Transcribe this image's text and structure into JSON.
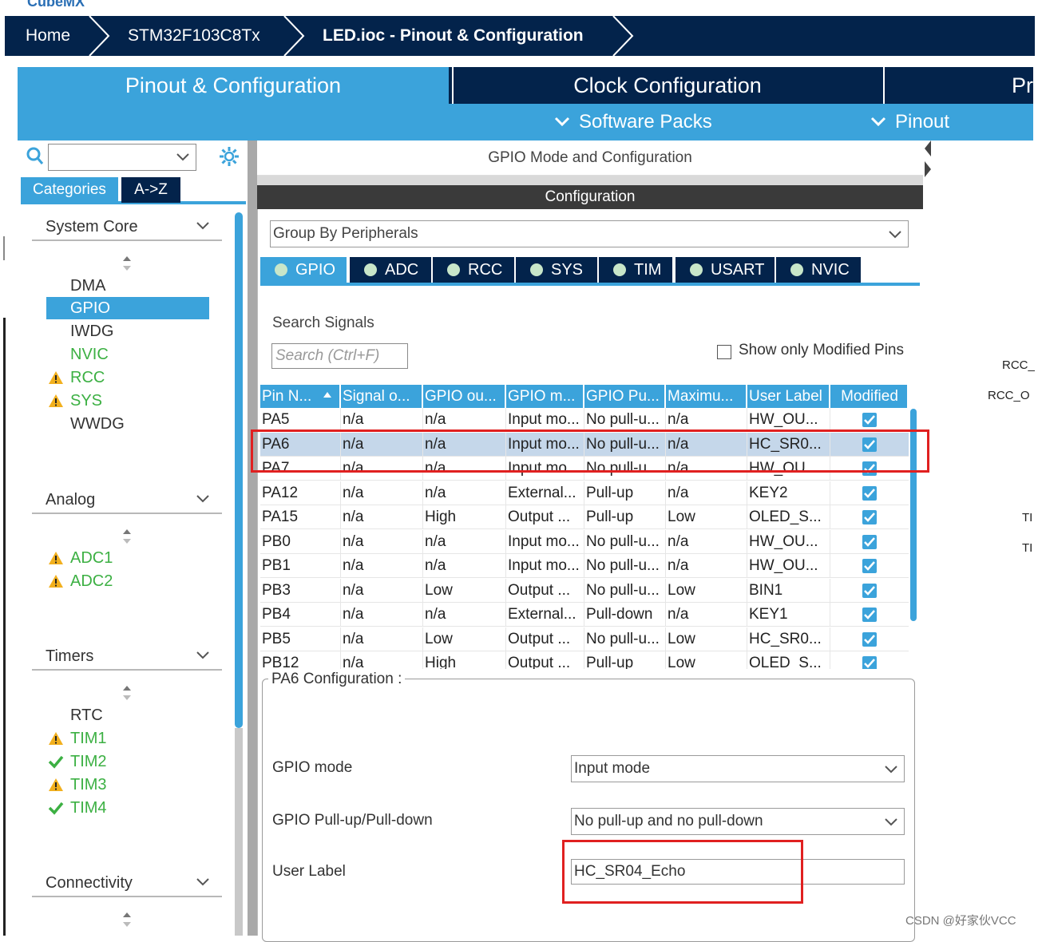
{
  "app": {
    "logo_text": "CubeMX"
  },
  "breadcrumb": [
    "Home",
    "STM32F103C8Tx",
    "LED.ioc - Pinout & Configuration"
  ],
  "main_tabs": [
    "Pinout & Configuration",
    "Clock Configuration",
    "Pr"
  ],
  "sub_tabs": [
    "Software Packs",
    "Pinout"
  ],
  "left": {
    "search_value": "",
    "cat_tabs": [
      "Categories",
      "A->Z"
    ],
    "sections": {
      "system_core": {
        "title": "System Core",
        "items": [
          {
            "label": "DMA",
            "status": "none"
          },
          {
            "label": "GPIO",
            "status": "selected"
          },
          {
            "label": "IWDG",
            "status": "none"
          },
          {
            "label": "NVIC",
            "status": "ok"
          },
          {
            "label": "RCC",
            "status": "warning"
          },
          {
            "label": "SYS",
            "status": "warning"
          },
          {
            "label": "WWDG",
            "status": "none"
          }
        ]
      },
      "analog": {
        "title": "Analog",
        "items": [
          {
            "label": "ADC1",
            "status": "warning"
          },
          {
            "label": "ADC2",
            "status": "warning"
          }
        ]
      },
      "timers": {
        "title": "Timers",
        "items": [
          {
            "label": "RTC",
            "status": "none"
          },
          {
            "label": "TIM1",
            "status": "warning"
          },
          {
            "label": "TIM2",
            "status": "checked"
          },
          {
            "label": "TIM3",
            "status": "warning"
          },
          {
            "label": "TIM4",
            "status": "checked"
          }
        ]
      },
      "connectivity": {
        "title": "Connectivity"
      }
    }
  },
  "center": {
    "header": "GPIO Mode and Configuration",
    "config_header": "Configuration",
    "group_by": "Group By Peripherals",
    "peripheral_tabs": [
      "GPIO",
      "ADC",
      "RCC",
      "SYS",
      "TIM",
      "USART",
      "NVIC"
    ],
    "search_label": "Search Signals",
    "search_placeholder": "Search (Ctrl+F)",
    "show_modified_label": "Show only Modified Pins",
    "table": {
      "columns": [
        "Pin N...",
        "Signal o...",
        "GPIO ou...",
        "GPIO m...",
        "GPIO Pu...",
        "Maximu...",
        "User Label",
        "Modified"
      ],
      "rows": [
        [
          "PA5",
          "n/a",
          "n/a",
          "Input mo...",
          "No pull-u...",
          "n/a",
          "HW_OU...",
          true
        ],
        [
          "PA6",
          "n/a",
          "n/a",
          "Input mo...",
          "No pull-u...",
          "n/a",
          "HC_SR0...",
          true
        ],
        [
          "PA7",
          "n/a",
          "n/a",
          "Input mo...",
          "No pull-u...",
          "n/a",
          "HW_OU...",
          true
        ],
        [
          "PA12",
          "n/a",
          "n/a",
          "External...",
          "Pull-up",
          "n/a",
          "KEY2",
          true
        ],
        [
          "PA15",
          "n/a",
          "High",
          "Output ...",
          "Pull-up",
          "Low",
          "OLED_S...",
          true
        ],
        [
          "PB0",
          "n/a",
          "n/a",
          "Input mo...",
          "No pull-u...",
          "n/a",
          "HW_OU...",
          true
        ],
        [
          "PB1",
          "n/a",
          "n/a",
          "Input mo...",
          "No pull-u...",
          "n/a",
          "HW_OU...",
          true
        ],
        [
          "PB3",
          "n/a",
          "Low",
          "Output ...",
          "No pull-u...",
          "Low",
          "BIN1",
          true
        ],
        [
          "PB4",
          "n/a",
          "n/a",
          "External...",
          "Pull-down",
          "n/a",
          "KEY1",
          true
        ],
        [
          "PB5",
          "n/a",
          "Low",
          "Output ...",
          "No pull-u...",
          "Low",
          "HC_SR0...",
          true
        ],
        [
          "PB12",
          "n/a",
          "High",
          "Output ...",
          "Pull-up",
          "Low",
          "OLED_S...",
          true
        ]
      ],
      "selected_row": 1
    },
    "pin_config": {
      "title": "PA6 Configuration :",
      "gpio_mode_label": "GPIO mode",
      "gpio_mode_value": "Input mode",
      "pull_label": "GPIO Pull-up/Pull-down",
      "pull_value": "No pull-up and no pull-down",
      "user_label_label": "User Label",
      "user_label_value": "HC_SR04_Echo"
    }
  },
  "right": {
    "labels": [
      "RCC_",
      "RCC_O",
      "TI",
      "TI"
    ]
  },
  "watermark": "CSDN @好家伙VCC",
  "colors": {
    "navy": "#03234b",
    "accent": "#3ba3db",
    "green": "#3cb043",
    "warning": "#f2b01e",
    "highlight": "#e02020"
  }
}
